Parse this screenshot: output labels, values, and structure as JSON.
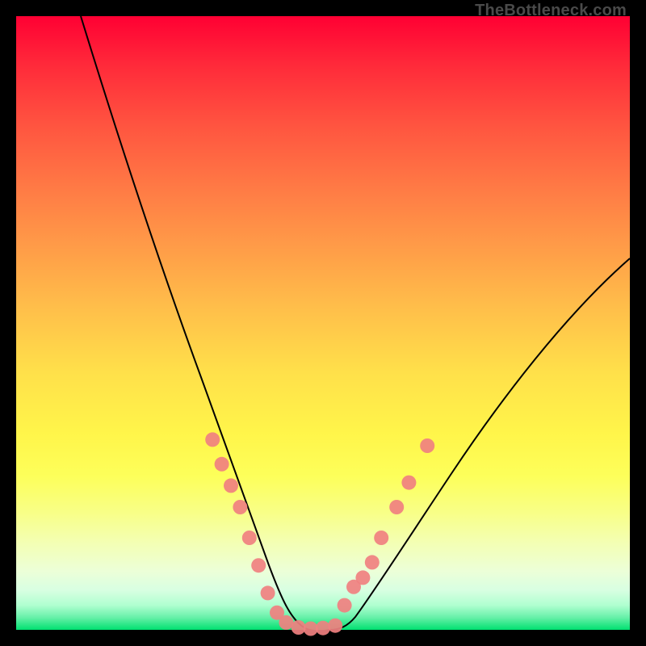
{
  "attribution": "TheBottleneck.com",
  "colors": {
    "marker": "#f08080",
    "curve": "#000000",
    "gradient_top": "#ff0033",
    "gradient_mid": "#ffe04a",
    "gradient_bottom": "#00e070"
  },
  "chart_data": {
    "type": "line",
    "title": "",
    "xlabel": "",
    "ylabel": "",
    "xlim": [
      0,
      100
    ],
    "ylim": [
      0,
      100
    ],
    "grid": false,
    "legend": false,
    "description": "Two-branch bottleneck curve over a vertical heat gradient. Left branch descends steeply from top-left to a flat valley around x≈42–50, y≈0. Right branch rises from the valley toward upper-right, ending near y≈60 at x=100.",
    "series": [
      {
        "name": "left_branch",
        "x": [
          10,
          14,
          18,
          22,
          26,
          30,
          33,
          36,
          38,
          40,
          42,
          44,
          46,
          48,
          50
        ],
        "y": [
          100,
          88,
          76,
          64,
          52,
          41,
          32,
          24,
          17,
          11,
          6,
          3,
          1,
          0,
          0
        ]
      },
      {
        "name": "right_branch",
        "x": [
          50,
          52,
          54,
          56,
          58,
          60,
          64,
          68,
          72,
          76,
          80,
          84,
          88,
          92,
          96,
          100
        ],
        "y": [
          0,
          1,
          3,
          5,
          8,
          11,
          17,
          23,
          29,
          35,
          40,
          45,
          49,
          53,
          57,
          60
        ]
      }
    ],
    "markers": {
      "name": "highlighted_points",
      "points": [
        {
          "x": 32.0,
          "y": 31.0
        },
        {
          "x": 33.5,
          "y": 27.0
        },
        {
          "x": 35.0,
          "y": 23.5
        },
        {
          "x": 36.5,
          "y": 20.0
        },
        {
          "x": 38.0,
          "y": 15.0
        },
        {
          "x": 39.5,
          "y": 10.5
        },
        {
          "x": 41.0,
          "y": 6.0
        },
        {
          "x": 42.5,
          "y": 2.8
        },
        {
          "x": 44.0,
          "y": 1.2
        },
        {
          "x": 46.0,
          "y": 0.4
        },
        {
          "x": 48.0,
          "y": 0.2
        },
        {
          "x": 50.0,
          "y": 0.3
        },
        {
          "x": 52.0,
          "y": 0.7
        },
        {
          "x": 53.5,
          "y": 4.0
        },
        {
          "x": 55.0,
          "y": 7.0
        },
        {
          "x": 56.5,
          "y": 8.5
        },
        {
          "x": 58.0,
          "y": 11.0
        },
        {
          "x": 59.5,
          "y": 15.0
        },
        {
          "x": 62.0,
          "y": 20.0
        },
        {
          "x": 64.0,
          "y": 24.0
        },
        {
          "x": 67.0,
          "y": 30.0
        }
      ]
    }
  }
}
